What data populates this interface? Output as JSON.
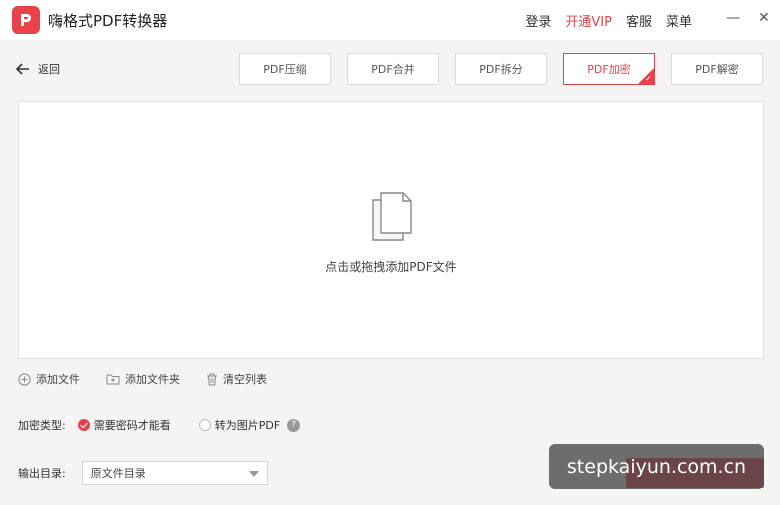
{
  "app": {
    "title": "嗨格式PDF转换器"
  },
  "topnav": {
    "login": "登录",
    "vip": "开通VIP",
    "service": "客服",
    "menu": "菜单"
  },
  "window": {
    "minimize": "—",
    "close": "✕"
  },
  "back": {
    "label": "返回"
  },
  "tabs": [
    {
      "label": "PDF压缩",
      "active": false
    },
    {
      "label": "PDF合并",
      "active": false
    },
    {
      "label": "PDF拆分",
      "active": false
    },
    {
      "label": "PDF加密",
      "active": true
    },
    {
      "label": "PDF解密",
      "active": false
    }
  ],
  "dropzone": {
    "text": "点击或拖拽添加PDF文件"
  },
  "actions": {
    "add_file": "添加文件",
    "add_folder": "添加文件夹",
    "clear_list": "清空列表"
  },
  "encryption": {
    "label": "加密类型:",
    "options": [
      {
        "label": "需要密码才能看",
        "selected": true
      },
      {
        "label": "转为图片PDF",
        "selected": false
      }
    ],
    "help": "?"
  },
  "output": {
    "label": "输出目录:",
    "selected": "原文件目录"
  },
  "watermark": {
    "text": "stepkaiyun.com.cn"
  },
  "colors": {
    "accent": "#e8424b",
    "background": "#f4f4f4"
  }
}
